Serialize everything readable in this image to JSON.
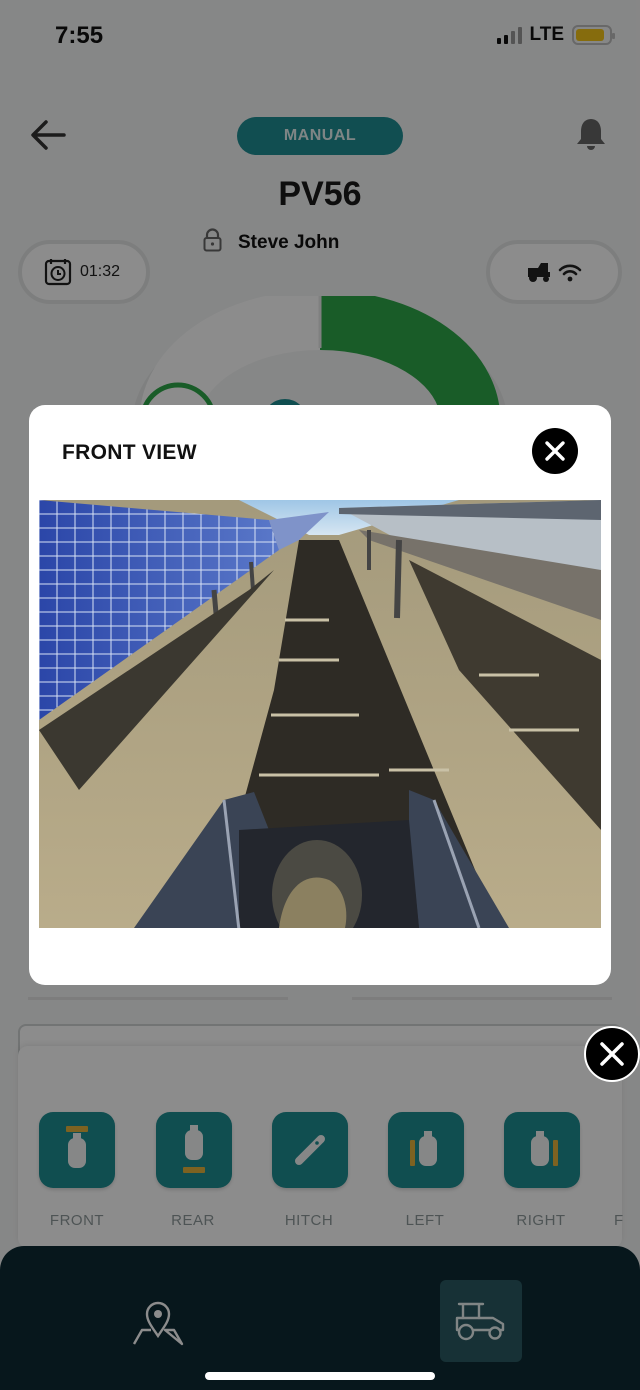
{
  "status_bar": {
    "time": "7:55",
    "network": "LTE"
  },
  "header": {
    "mode": "MANUAL",
    "vehicle_name": "PV56",
    "operator": "Steve John"
  },
  "timer": {
    "value": "01:32"
  },
  "modal": {
    "title": "FRONT VIEW"
  },
  "camera_buttons": [
    {
      "label": "FRONT"
    },
    {
      "label": "REAR"
    },
    {
      "label": "HITCH"
    },
    {
      "label": "LEFT"
    },
    {
      "label": "RIGHT"
    },
    {
      "label": "F"
    }
  ],
  "colors": {
    "accent_teal": "#1e8e93",
    "gauge_green": "#2fa84a",
    "nav_background": "#0d2a33",
    "battery_yellow": "#f5c518"
  },
  "icons": {
    "back": "arrow-left-icon",
    "notifications": "bell-icon",
    "lock": "lock-icon",
    "timer": "alarm-clock-icon",
    "connection": "tractor-wifi-icon",
    "close": "close-icon",
    "map": "map-pin-icon",
    "vehicle": "tractor-icon"
  }
}
